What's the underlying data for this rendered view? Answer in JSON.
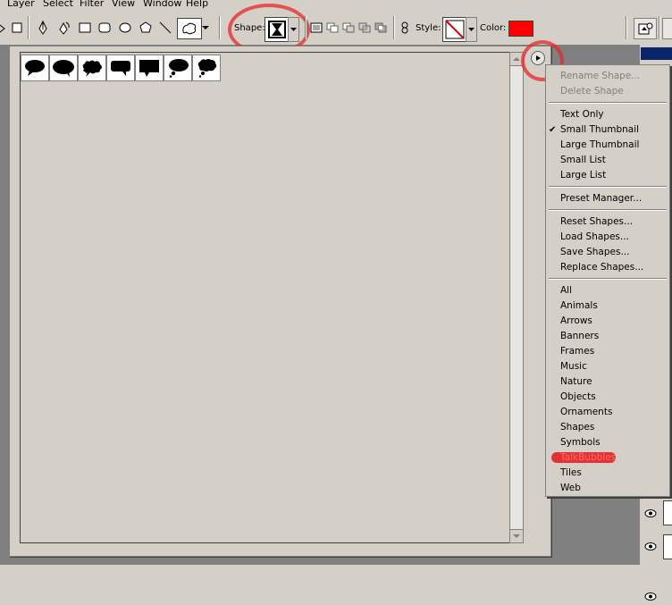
{
  "menubar": {
    "items": [
      "Layer",
      "Select",
      "Filter",
      "View",
      "Window",
      "Help"
    ]
  },
  "toolbar": {
    "shape_label": "Shape:",
    "style_label": "Style:",
    "color_label": "Color:",
    "color_value": "#ff0000",
    "tools": [
      "pen-icon",
      "freeform-pen-icon",
      "rectangle-icon",
      "rounded-rectangle-icon",
      "ellipse-icon",
      "polygon-icon",
      "line-icon",
      "custom-shape-icon"
    ],
    "path_ops": [
      "add-shape-area-icon",
      "subtract-shape-area-icon",
      "intersect-shape-area-icon",
      "exclude-shape-area-icon"
    ]
  },
  "shape_picker": {
    "thumbnails": [
      "oval-talk-bubble",
      "wide-oval-talk-bubble",
      "cloud-talk-bubble",
      "rectangle-talk-bubble",
      "square-talk-bubble",
      "thought-bubble",
      "cloud-thought-bubble"
    ]
  },
  "flyout_menu": {
    "groups": [
      {
        "items": [
          {
            "label": "Rename Shape...",
            "enabled": false
          },
          {
            "label": "Delete Shape",
            "enabled": false
          }
        ]
      },
      {
        "items": [
          {
            "label": "Text Only",
            "enabled": true,
            "checked": false
          },
          {
            "label": "Small Thumbnail",
            "enabled": true,
            "checked": true
          },
          {
            "label": "Large Thumbnail",
            "enabled": true,
            "checked": false
          },
          {
            "label": "Small List",
            "enabled": true,
            "checked": false
          },
          {
            "label": "Large List",
            "enabled": true,
            "checked": false
          }
        ]
      },
      {
        "items": [
          {
            "label": "Preset Manager...",
            "enabled": true
          }
        ]
      },
      {
        "items": [
          {
            "label": "Reset Shapes...",
            "enabled": true
          },
          {
            "label": "Load Shapes...",
            "enabled": true
          },
          {
            "label": "Save Shapes...",
            "enabled": true
          },
          {
            "label": "Replace Shapes...",
            "enabled": true
          }
        ]
      },
      {
        "items": [
          {
            "label": "All",
            "enabled": true
          },
          {
            "label": "Animals",
            "enabled": true
          },
          {
            "label": "Arrows",
            "enabled": true
          },
          {
            "label": "Banners",
            "enabled": true
          },
          {
            "label": "Frames",
            "enabled": true
          },
          {
            "label": "Music",
            "enabled": true
          },
          {
            "label": "Nature",
            "enabled": true
          },
          {
            "label": "Objects",
            "enabled": true
          },
          {
            "label": "Ornaments",
            "enabled": true
          },
          {
            "label": "Shapes",
            "enabled": true
          },
          {
            "label": "Symbols",
            "enabled": true
          },
          {
            "label": "TalkBubbles",
            "enabled": true,
            "highlighted": true
          },
          {
            "label": "Tiles",
            "enabled": true
          },
          {
            "label": "Web",
            "enabled": true
          }
        ]
      }
    ]
  },
  "annotations": {
    "color": "#e32020",
    "circled": [
      "shape-picker-button",
      "flyout-menu-button"
    ]
  }
}
